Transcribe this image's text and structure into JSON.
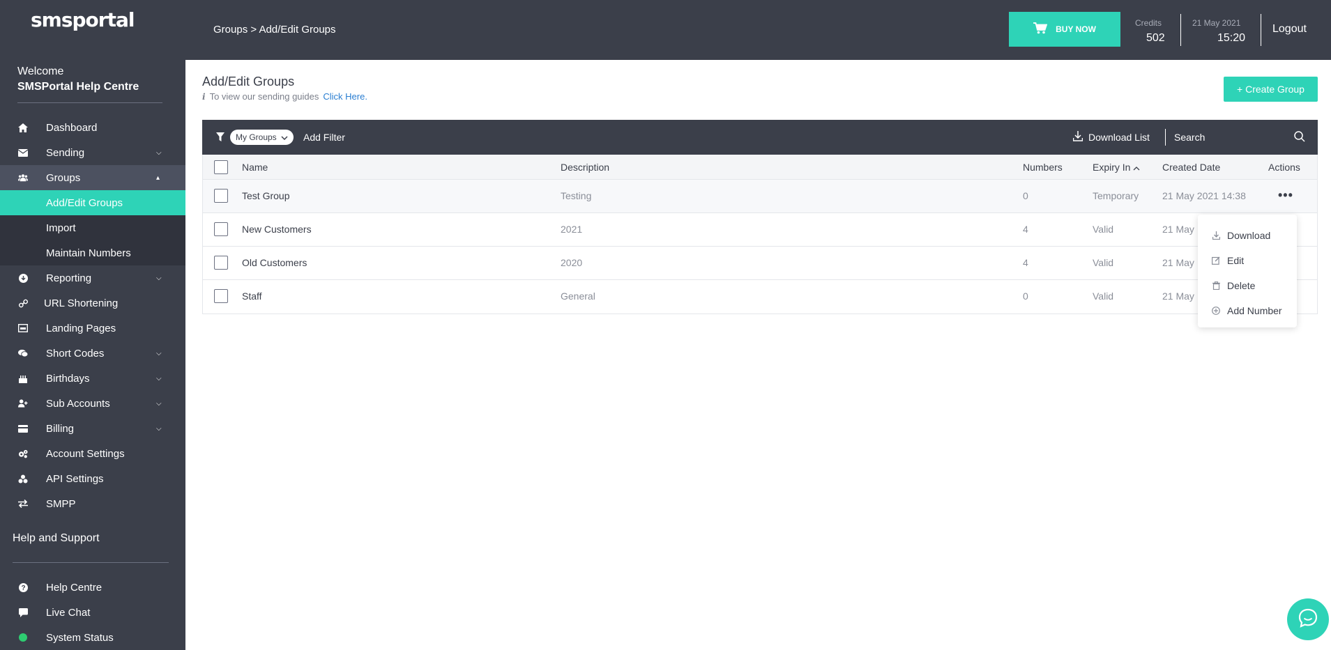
{
  "brand": {
    "logo_text": "smsportal"
  },
  "sidebar": {
    "welcome": "Welcome",
    "user_name": "SMSPortal Help Centre",
    "nav": [
      {
        "label": "Dashboard",
        "icon": "home-icon"
      },
      {
        "label": "Sending",
        "icon": "envelope-icon"
      },
      {
        "label": "Groups",
        "icon": "users-icon"
      },
      {
        "label": "Add/Edit Groups"
      },
      {
        "label": "Import"
      },
      {
        "label": "Maintain Numbers"
      },
      {
        "label": "Reporting",
        "icon": "chart-icon"
      },
      {
        "label": "URL Shortening",
        "icon": "link-icon"
      },
      {
        "label": "Landing Pages",
        "icon": "page-icon"
      },
      {
        "label": "Short Codes",
        "icon": "chat-icon"
      },
      {
        "label": "Birthdays",
        "icon": "cake-icon"
      },
      {
        "label": "Sub Accounts",
        "icon": "user-plus-icon"
      },
      {
        "label": "Billing",
        "icon": "card-icon"
      },
      {
        "label": "Account Settings",
        "icon": "gears-icon"
      },
      {
        "label": "API Settings",
        "icon": "api-icon"
      },
      {
        "label": "SMPP",
        "icon": "exchange-icon"
      }
    ],
    "help_title": "Help and Support",
    "help": [
      {
        "label": "Help Centre",
        "icon": "question-icon"
      },
      {
        "label": "Live Chat",
        "icon": "speech-icon"
      },
      {
        "label": "System Status",
        "icon": "status-dot-icon"
      }
    ]
  },
  "topbar": {
    "breadcrumb": "Groups > Add/Edit Groups",
    "buy_now": "BUY NOW",
    "credits_label": "Credits",
    "credits_value": "502",
    "date": "21 May 2021",
    "time": "15:20",
    "logout": "Logout"
  },
  "main": {
    "title": "Add/Edit Groups",
    "guide_text": "To view our sending guides",
    "guide_link": "Click Here.",
    "create_button": "+ Create Group"
  },
  "toolbar": {
    "filter_chip": "My Groups",
    "add_filter": "Add Filter",
    "download_list": "Download List",
    "search_placeholder": "Search"
  },
  "table": {
    "columns": [
      "Name",
      "Description",
      "Numbers",
      "Expiry In",
      "Created Date",
      "Actions"
    ],
    "rows": [
      {
        "name": "Test Group",
        "description": "Testing",
        "numbers": "0",
        "expiry": "Temporary",
        "created": "21 May 2021 14:38"
      },
      {
        "name": "New Customers",
        "description": "2021",
        "numbers": "4",
        "expiry": "Valid",
        "created": "21 May"
      },
      {
        "name": "Old Customers",
        "description": "2020",
        "numbers": "4",
        "expiry": "Valid",
        "created": "21 May"
      },
      {
        "name": "Staff",
        "description": "General",
        "numbers": "0",
        "expiry": "Valid",
        "created": "21 May"
      }
    ]
  },
  "action_menu": {
    "items": [
      {
        "label": "Download",
        "icon": "download-icon"
      },
      {
        "label": "Edit",
        "icon": "edit-icon"
      },
      {
        "label": "Delete",
        "icon": "trash-icon"
      },
      {
        "label": "Add Number",
        "icon": "plus-circle-icon"
      }
    ]
  },
  "colors": {
    "accent": "#2ed3b7",
    "dark": "#3b3f4a",
    "link": "#2a7ed1"
  }
}
